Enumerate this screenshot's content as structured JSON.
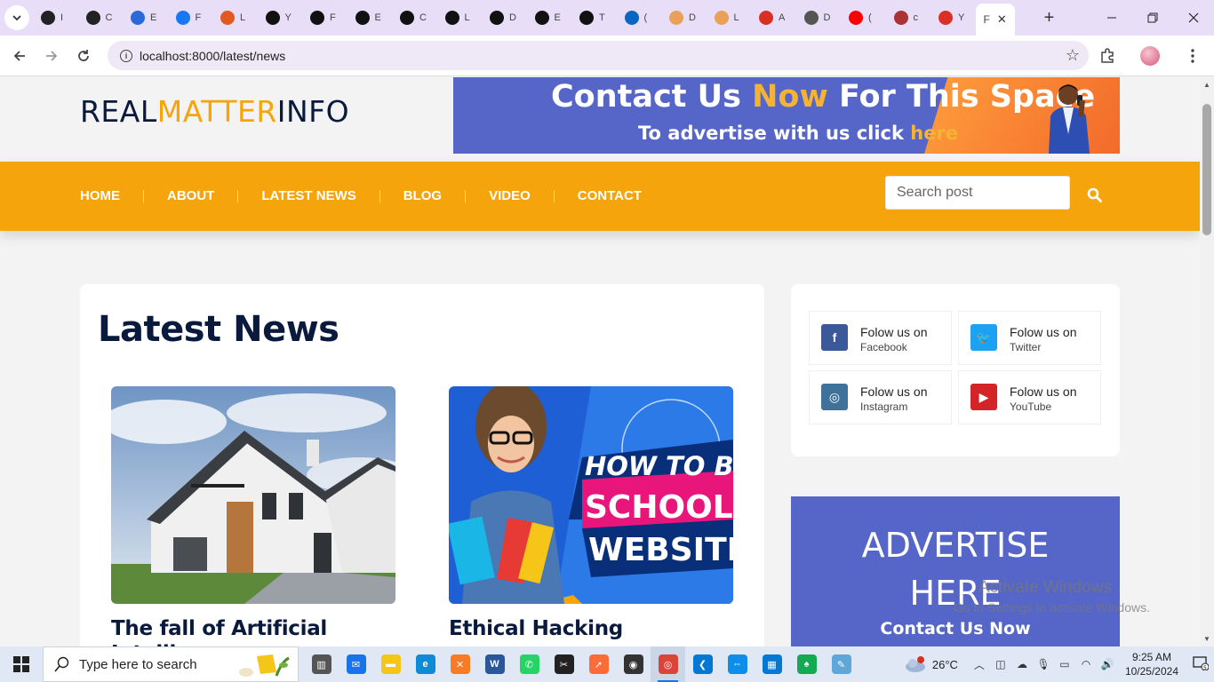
{
  "browser": {
    "tabs": [
      {
        "icon": "openai-icon",
        "short": "I",
        "color": "#222"
      },
      {
        "icon": "openai-icon",
        "short": "C",
        "color": "#222"
      },
      {
        "icon": "ef-icon",
        "short": "E",
        "color": "#2a6ad8"
      },
      {
        "icon": "facebook-icon",
        "short": "F",
        "color": "#1877f2"
      },
      {
        "icon": "codeigniter-icon",
        "short": "L",
        "color": "#e2591f"
      },
      {
        "icon": "upwork-icon",
        "short": "Y",
        "color": "#111"
      },
      {
        "icon": "upwork-icon",
        "short": "F",
        "color": "#111"
      },
      {
        "icon": "upwork-icon",
        "short": "E",
        "color": "#111"
      },
      {
        "icon": "upwork-icon",
        "short": "C",
        "color": "#111"
      },
      {
        "icon": "upwork-icon",
        "short": "L",
        "color": "#111"
      },
      {
        "icon": "upwork-icon",
        "short": "D",
        "color": "#111"
      },
      {
        "icon": "upwork-icon",
        "short": "E",
        "color": "#111"
      },
      {
        "icon": "upwork-icon",
        "short": "T",
        "color": "#111"
      },
      {
        "icon": "linkedin-icon",
        "short": "(",
        "color": "#0a66c2"
      },
      {
        "icon": "loop-icon",
        "short": "D",
        "color": "#e9a15a"
      },
      {
        "icon": "loop-icon",
        "short": "L",
        "color": "#e9a15a"
      },
      {
        "icon": "gmail-icon",
        "short": "A",
        "color": "#d93025"
      },
      {
        "icon": "globe-icon",
        "short": "D",
        "color": "#555"
      },
      {
        "icon": "youtube-icon",
        "short": "(",
        "color": "#ff0000"
      },
      {
        "icon": "cbar-icon",
        "short": "c",
        "color": "#a33"
      },
      {
        "icon": "gmail-icon",
        "short": "Y",
        "color": "#d93025"
      }
    ],
    "active_tab": {
      "short": "F",
      "close": "✕"
    },
    "new_tab": "+",
    "url": "localhost:8000/latest/news"
  },
  "site": {
    "logo": {
      "part1": "REAL",
      "part2": "MATTER",
      "part3": "INFO"
    },
    "banner": {
      "line1_a": "Contact Us ",
      "line1_b": "Now",
      "line1_c": " For This Space",
      "line2_a": "To advertise with us click ",
      "line2_b": "here"
    },
    "menu": [
      "HOME",
      "ABOUT",
      "LATEST NEWS",
      "BLOG",
      "VIDEO",
      "CONTACT"
    ],
    "search_placeholder": "Search post",
    "heading": "Latest News",
    "news": [
      {
        "title": "The fall of Artificial Intelligence"
      },
      {
        "title": "Ethical Hacking",
        "image_text": {
          "line1": "HOW TO BU",
          "line2": "SCHOOL",
          "line3": "WEBSITE"
        }
      }
    ],
    "social": [
      {
        "title": "Folow us on",
        "network": "Facebook",
        "color": "#3b5998",
        "icon": "facebook-icon"
      },
      {
        "title": "Folow us on",
        "network": "Twitter",
        "color": "#1da1f2",
        "icon": "twitter-icon"
      },
      {
        "title": "Folow us on",
        "network": "Instagram",
        "color": "#3f729b",
        "icon": "instagram-icon"
      },
      {
        "title": "Folow us on",
        "network": "YouTube",
        "color": "#d42428",
        "icon": "youtube-icon"
      }
    ],
    "ad": {
      "line1": "ADVERTISE",
      "line2": "HERE",
      "cta": "Contact Us Now"
    }
  },
  "watermark": {
    "line1": "Activate Windows",
    "line2": "Go to Settings to activate Windows."
  },
  "taskbar": {
    "search_placeholder": "Type here to search",
    "weather": "26°C",
    "time": "9:25 AM",
    "date": "10/25/2024",
    "notifications": "5"
  },
  "colors": {
    "accent": "#f5a50b",
    "navy": "#0a1a3c",
    "ad_blue": "#5566c8"
  }
}
